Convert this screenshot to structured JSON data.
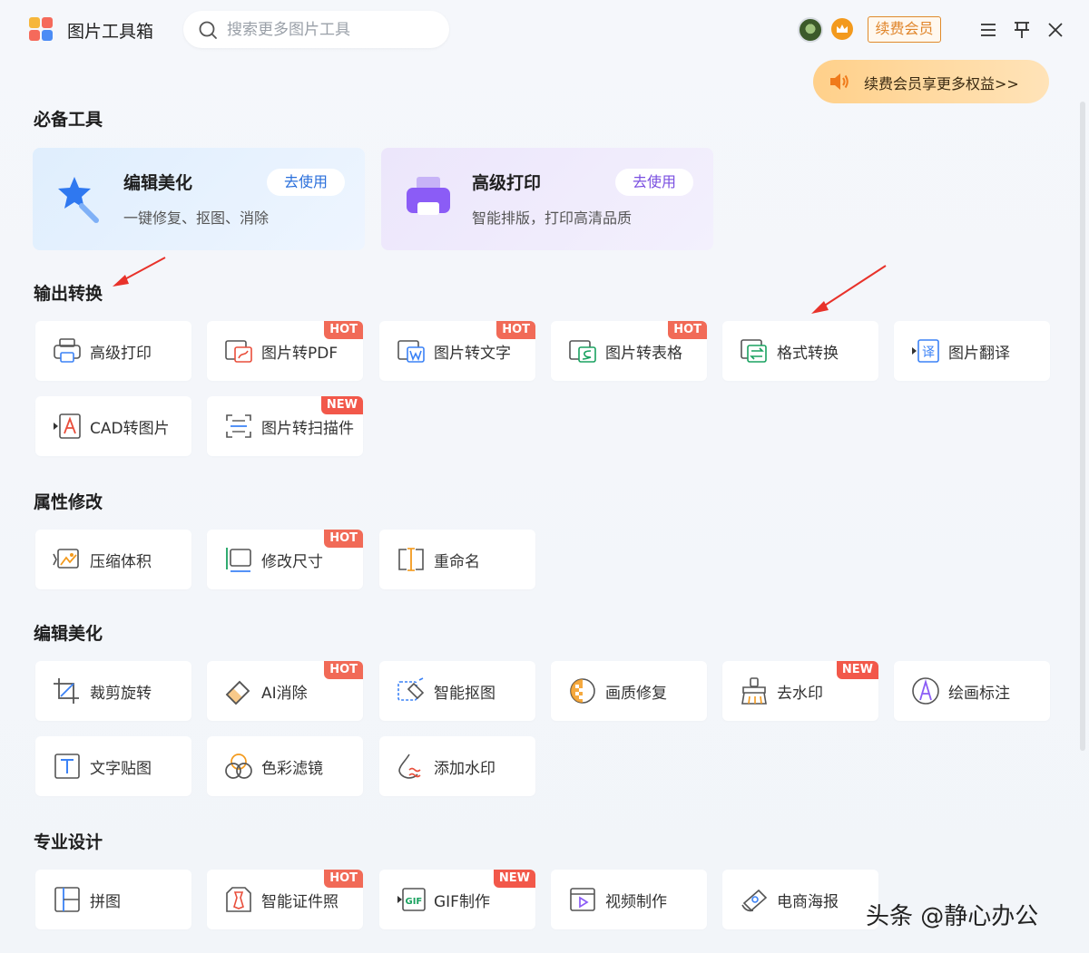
{
  "app": {
    "title": "图片工具箱"
  },
  "search": {
    "placeholder": "搜索更多图片工具",
    "value": ""
  },
  "header": {
    "renew_label": "续费会员"
  },
  "promo": {
    "text": "续费会员享更多权益>>"
  },
  "colors": {
    "accent_orange": "#e0852a",
    "hot_badge": "#f16a57",
    "icon_blue": "#2a6fdb",
    "icon_purple": "#8b5cf6"
  },
  "sections": {
    "essential": "必备工具",
    "output": "输出转换",
    "attributes": "属性修改",
    "edit": "编辑美化",
    "design": "专业设计"
  },
  "featured": [
    {
      "title": "编辑美化",
      "desc": "一键修复、抠图、消除",
      "button": "去使用"
    },
    {
      "title": "高级打印",
      "desc": "智能排版，打印高清品质",
      "button": "去使用"
    }
  ],
  "output_tools": [
    {
      "label": "高级打印",
      "badge": ""
    },
    {
      "label": "图片转PDF",
      "badge": "HOT"
    },
    {
      "label": "图片转文字",
      "badge": "HOT"
    },
    {
      "label": "图片转表格",
      "badge": "HOT"
    },
    {
      "label": "格式转换",
      "badge": ""
    },
    {
      "label": "图片翻译",
      "badge": ""
    },
    {
      "label": "CAD转图片",
      "badge": ""
    },
    {
      "label": "图片转扫描件",
      "badge": "NEW"
    }
  ],
  "attribute_tools": [
    {
      "label": "压缩体积",
      "badge": ""
    },
    {
      "label": "修改尺寸",
      "badge": "HOT"
    },
    {
      "label": "重命名",
      "badge": ""
    }
  ],
  "edit_tools": [
    {
      "label": "裁剪旋转",
      "badge": ""
    },
    {
      "label": "AI消除",
      "badge": "HOT"
    },
    {
      "label": "智能抠图",
      "badge": ""
    },
    {
      "label": "画质修复",
      "badge": ""
    },
    {
      "label": "去水印",
      "badge": "NEW"
    },
    {
      "label": "绘画标注",
      "badge": ""
    },
    {
      "label": "文字贴图",
      "badge": ""
    },
    {
      "label": "色彩滤镜",
      "badge": ""
    },
    {
      "label": "添加水印",
      "badge": ""
    }
  ],
  "design_tools": [
    {
      "label": "拼图",
      "badge": ""
    },
    {
      "label": "智能证件照",
      "badge": "HOT"
    },
    {
      "label": "GIF制作",
      "badge": "NEW"
    },
    {
      "label": "视频制作",
      "badge": ""
    },
    {
      "label": "电商海报",
      "badge": ""
    }
  ],
  "watermark": {
    "text": "头条 @静心办公"
  }
}
